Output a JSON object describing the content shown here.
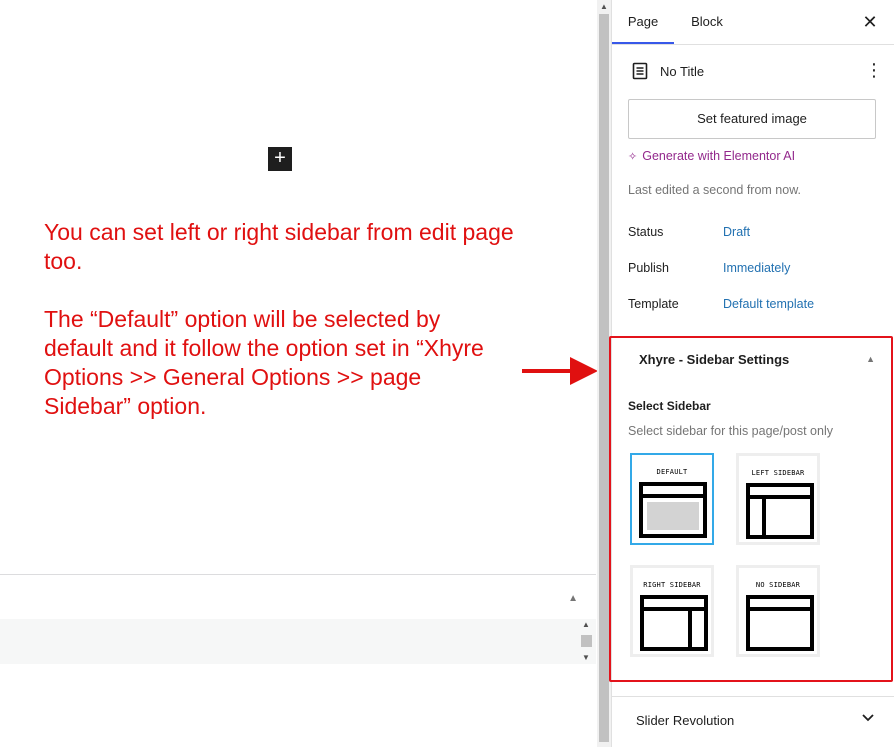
{
  "canvas": {
    "add_block_symbol": "+",
    "annotation": [
      "You can set left or right sidebar from edit page too.",
      "The “Default” option will be selected by default and it follow the option set in “Xhyre Options >> General Options >> page Sidebar” option."
    ]
  },
  "sidebar": {
    "tabs": [
      {
        "label": "Page"
      },
      {
        "label": "Block"
      }
    ],
    "close_symbol": "✕",
    "document": {
      "title": "No Title",
      "icon": "document-icon"
    },
    "more_symbol": "⋮",
    "featured_image_label": "Set featured image",
    "elementor_ai": {
      "icon": "sparkle-icon",
      "label": "Generate with Elementor AI"
    },
    "last_edited": "Last edited a second from now.",
    "meta": [
      {
        "label": "Status",
        "value": "Draft"
      },
      {
        "label": "Publish",
        "value": "Immediately"
      },
      {
        "label": "Template",
        "value": "Default template"
      }
    ],
    "xhyre_panel": {
      "title": "Xhyre - Sidebar Settings",
      "select_label": "Select Sidebar",
      "select_description": "Select sidebar for this page/post only",
      "options": [
        {
          "label": "DEFAULT",
          "selected": true
        },
        {
          "label": "LEFT SIDEBAR",
          "selected": false
        },
        {
          "label": "RIGHT SIDEBAR",
          "selected": false
        },
        {
          "label": "NO SIDEBAR",
          "selected": false
        }
      ],
      "highlight_color": "#e3131b",
      "selected_color": "#33a9e8"
    },
    "slider_revolution": {
      "label": "Slider Revolution"
    }
  },
  "colors": {
    "annotation": "#e01010",
    "link": "#2271b1",
    "elementor": "#93288c",
    "tab_active": "#3858e9"
  }
}
